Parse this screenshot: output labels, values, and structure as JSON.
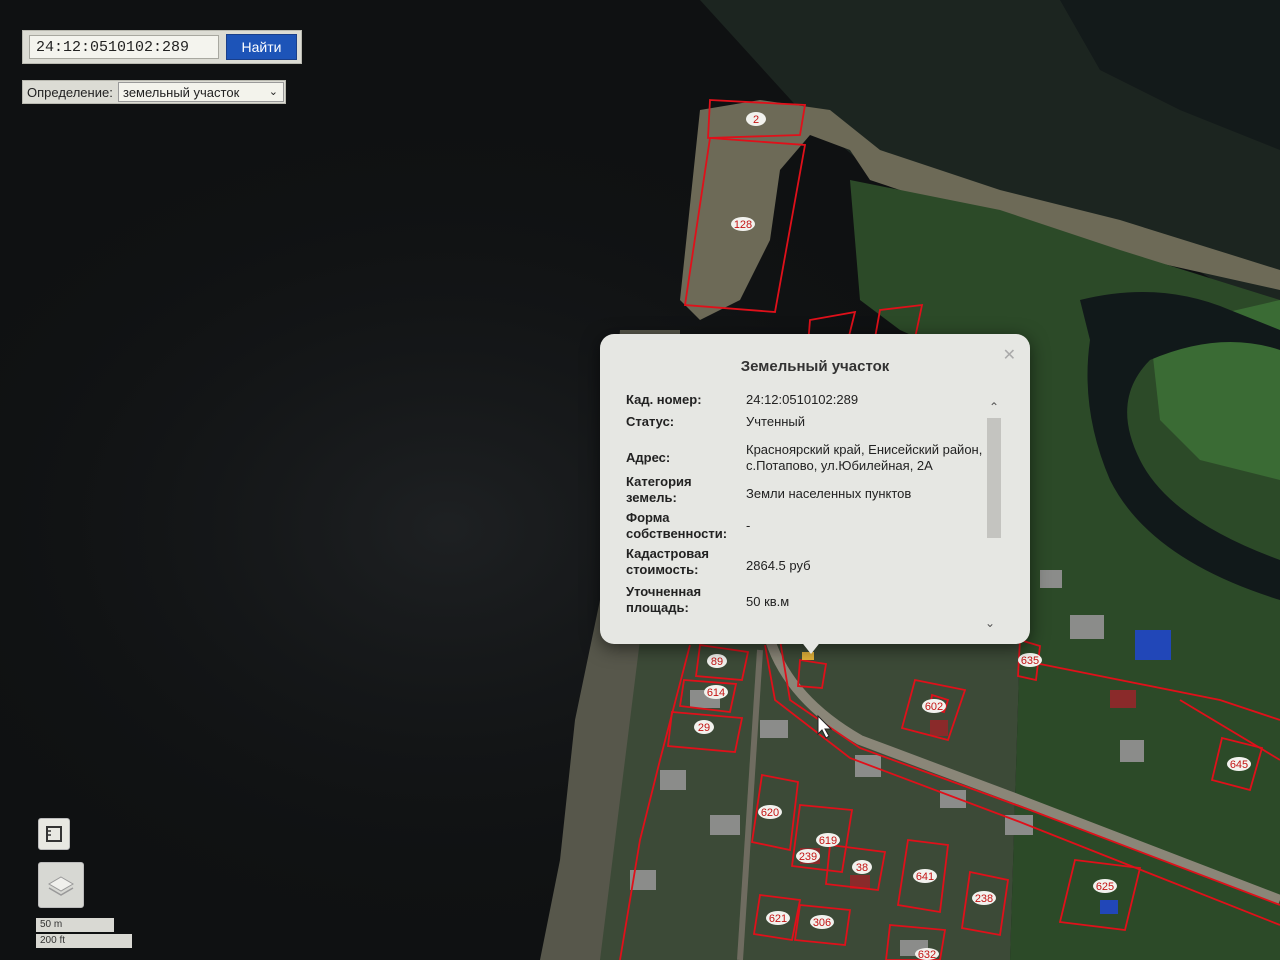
{
  "search": {
    "value": "24:12:0510102:289",
    "button_label": "Найти"
  },
  "definition": {
    "label": "Определение:",
    "selected": "земельный участок"
  },
  "popup": {
    "title": "Земельный участок",
    "fields": [
      {
        "label": "Кад. номер:",
        "value": "24:12:0510102:289"
      },
      {
        "label": "Статус:",
        "value": "Учтенный"
      },
      {
        "label": "Адрес:",
        "value": "Красноярский край, Енисейский район, с.Потапово, ул.Юбилейная, 2А"
      },
      {
        "label": "Категория земель:",
        "value": "Земли населенных пунктов"
      },
      {
        "label": "Форма собственности:",
        "value": "-"
      },
      {
        "label": "Кадастровая стоимость:",
        "value": "2864.5 руб"
      },
      {
        "label": "Уточненная площадь:",
        "value": "50 кв.м"
      }
    ]
  },
  "parcels": [
    "2",
    "128",
    "89",
    "614",
    "29",
    "602",
    "635",
    "645",
    "620",
    "619",
    "239",
    "38",
    "641",
    "238",
    "625",
    "621",
    "306",
    "632"
  ],
  "scale": {
    "metric": "50 m",
    "imperial": "200 ft"
  },
  "colors": {
    "parcel_outline": "#e0101a",
    "search_button": "#1d54b8",
    "popup_bg": "#e6e7e3"
  }
}
